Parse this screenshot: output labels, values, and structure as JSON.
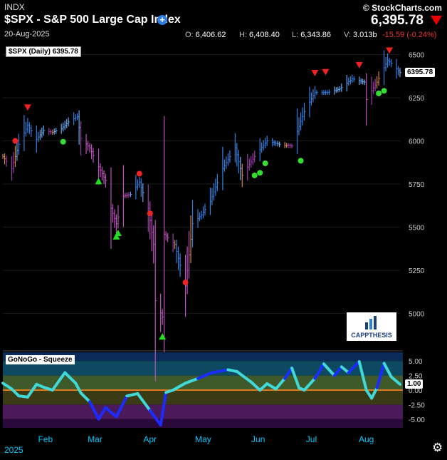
{
  "header": {
    "exchange": "INDX",
    "title": "$SPX - S&P 500 Large Cap Index",
    "date": "20-Aug-2025",
    "brand": "© StockCharts.com",
    "last": "6,395.78",
    "open_label": "O:",
    "open": "6,406.62",
    "high_label": "H:",
    "high": "6,408.40",
    "low_label": "L:",
    "low": "6,343.86",
    "vol_label": "V:",
    "volume": "3.013b",
    "change": "-15.59 (-0.24%)"
  },
  "legend": "$SPX (Daily) 6395.78",
  "last_tag": "6395.78",
  "squeeze_label": "GoNoGo - Squeeze",
  "squeeze_tag": "1.00",
  "logo_text": "CAPPTHESIS",
  "year": "2025",
  "colors": {
    "go_strong": "#2f7fe0",
    "go_weak": "#66a8f0",
    "nogo_strong": "#c050c0",
    "nogo_weak": "#9a3aa8",
    "amber": "#d08040",
    "up_signal": "#22dd22",
    "down_signal": "#ee2222",
    "continue_dot": "#33dd33",
    "squeeze_high": "#1a2cff",
    "squeeze_low": "#40d8d8"
  },
  "chart_data": [
    {
      "type": "line",
      "title": "$SPX (Daily) 6395.78",
      "ylim": [
        4800,
        6560
      ],
      "yticks": [
        "6500",
        "6250",
        "6000",
        "5750",
        "5500",
        "5250",
        "5000"
      ],
      "ytick_values": [
        6500,
        6250,
        6000,
        5750,
        5500,
        5250,
        5000
      ],
      "xticks": [
        "Feb",
        "Mar",
        "Apr",
        "May",
        "Jun",
        "Jul",
        "Aug"
      ],
      "xtick_positions": [
        "2025-02-01",
        "2025-03-01",
        "2025-04-01",
        "2025-05-01",
        "2025-06-01",
        "2025-07-01",
        "2025-08-01"
      ],
      "x_start": "2025-01-08",
      "x_end": "2025-08-20",
      "series": [
        {
          "points": [
            [
              "2025-01-08",
              5910
            ],
            [
              "2025-01-13",
              5840
            ],
            [
              "2025-01-17",
              5980
            ],
            [
              "2025-01-22",
              6090
            ],
            [
              "2025-01-27",
              6010
            ],
            [
              "2025-01-31",
              6060
            ],
            [
              "2025-02-05",
              6050
            ],
            [
              "2025-02-10",
              6070
            ],
            [
              "2025-02-14",
              6110
            ],
            [
              "2025-02-19",
              6140
            ],
            [
              "2025-02-21",
              6015
            ],
            [
              "2025-02-26",
              5960
            ],
            [
              "2025-03-03",
              5850
            ],
            [
              "2025-03-07",
              5770
            ],
            [
              "2025-03-10",
              5610
            ],
            [
              "2025-03-13",
              5520
            ],
            [
              "2025-03-17",
              5680
            ],
            [
              "2025-03-21",
              5690
            ],
            [
              "2025-03-26",
              5760
            ],
            [
              "2025-03-31",
              5610
            ],
            [
              "2025-04-03",
              5400
            ],
            [
              "2025-04-04",
              5075
            ],
            [
              "2025-04-08",
              4980
            ],
            [
              "2025-04-09",
              5460
            ],
            [
              "2025-04-15",
              5400
            ],
            [
              "2025-04-21",
              5160
            ],
            [
              "2025-04-25",
              5520
            ],
            [
              "2025-04-30",
              5570
            ],
            [
              "2025-05-05",
              5650
            ],
            [
              "2025-05-12",
              5840
            ],
            [
              "2025-05-19",
              5960
            ],
            [
              "2025-05-23",
              5800
            ],
            [
              "2025-05-30",
              5910
            ],
            [
              "2025-06-06",
              6000
            ],
            [
              "2025-06-13",
              5980
            ],
            [
              "2025-06-20",
              5970
            ],
            [
              "2025-06-27",
              6170
            ],
            [
              "2025-07-03",
              6280
            ],
            [
              "2025-07-10",
              6280
            ],
            [
              "2025-07-17",
              6300
            ],
            [
              "2025-07-24",
              6360
            ],
            [
              "2025-07-31",
              6340
            ],
            [
              "2025-08-01",
              6240
            ],
            [
              "2025-08-07",
              6340
            ],
            [
              "2025-08-13",
              6466
            ],
            [
              "2025-08-15",
              6450
            ],
            [
              "2025-08-20",
              6396
            ]
          ]
        }
      ],
      "signals": {
        "down_triangles": [
          [
            "2025-01-22",
            6195
          ],
          [
            "2025-07-03",
            6395
          ],
          [
            "2025-07-09",
            6400
          ],
          [
            "2025-07-28",
            6440
          ],
          [
            "2025-08-14",
            6525
          ]
        ],
        "up_triangles": [
          [
            "2025-03-03",
            5765
          ],
          [
            "2025-03-13",
            5445
          ],
          [
            "2025-03-14",
            5465
          ],
          [
            "2025-04-08",
            4865
          ]
        ],
        "red_dots": [
          [
            "2025-01-15",
            6000
          ],
          [
            "2025-03-26",
            5810
          ],
          [
            "2025-04-01",
            5580
          ],
          [
            "2025-04-21",
            5180
          ]
        ],
        "green_dots": [
          [
            "2025-02-11",
            5995
          ],
          [
            "2025-05-30",
            5800
          ],
          [
            "2025-06-02",
            5815
          ],
          [
            "2025-06-05",
            5870
          ],
          [
            "2025-06-25",
            5885
          ],
          [
            "2025-08-08",
            6275
          ],
          [
            "2025-08-11",
            6290
          ]
        ]
      }
    },
    {
      "type": "line",
      "title": "GoNoGo - Squeeze",
      "ylim": [
        -6.5,
        6.5
      ],
      "yticks": [
        "5.00",
        "2.50",
        "0.00",
        "-2.50",
        "-5.00"
      ],
      "ytick_values": [
        5,
        2.5,
        0,
        -2.5,
        -5
      ],
      "series": [
        {
          "points": [
            [
              "2025-01-08",
              1.2
            ],
            [
              "2025-01-13",
              0.2
            ],
            [
              "2025-01-17",
              -1.0
            ],
            [
              "2025-01-22",
              -1.2
            ],
            [
              "2025-01-27",
              1.0
            ],
            [
              "2025-01-31",
              0.5
            ],
            [
              "2025-02-05",
              0.0
            ],
            [
              "2025-02-12",
              3.0
            ],
            [
              "2025-02-18",
              1.2
            ],
            [
              "2025-02-21",
              -0.5
            ],
            [
              "2025-02-26",
              -2.0
            ],
            [
              "2025-03-03",
              -5.0
            ],
            [
              "2025-03-07",
              -3.0
            ],
            [
              "2025-03-13",
              -4.6
            ],
            [
              "2025-03-19",
              -1.0
            ],
            [
              "2025-03-25",
              -0.6
            ],
            [
              "2025-04-01",
              -3.5
            ],
            [
              "2025-04-07",
              -6.0
            ],
            [
              "2025-04-10",
              -0.4
            ],
            [
              "2025-04-14",
              0.0
            ],
            [
              "2025-04-21",
              1.2
            ],
            [
              "2025-04-28",
              2.0
            ],
            [
              "2025-05-06",
              3.0
            ],
            [
              "2025-05-15",
              3.5
            ],
            [
              "2025-05-20",
              3.2
            ],
            [
              "2025-05-28",
              1.4
            ],
            [
              "2025-06-02",
              0.0
            ],
            [
              "2025-06-06",
              1.1
            ],
            [
              "2025-06-11",
              0.2
            ],
            [
              "2025-06-16",
              2.0
            ],
            [
              "2025-06-20",
              3.8
            ],
            [
              "2025-06-24",
              0.4
            ],
            [
              "2025-06-27",
              0.0
            ],
            [
              "2025-07-03",
              2.0
            ],
            [
              "2025-07-08",
              4.5
            ],
            [
              "2025-07-14",
              2.5
            ],
            [
              "2025-07-18",
              4.0
            ],
            [
              "2025-07-22",
              3.0
            ],
            [
              "2025-07-28",
              4.9
            ],
            [
              "2025-08-01",
              0.0
            ],
            [
              "2025-08-04",
              -1.4
            ],
            [
              "2025-08-07",
              0.4
            ],
            [
              "2025-08-11",
              4.6
            ],
            [
              "2025-08-15",
              2.3
            ],
            [
              "2025-08-20",
              1.0
            ]
          ]
        }
      ]
    }
  ]
}
